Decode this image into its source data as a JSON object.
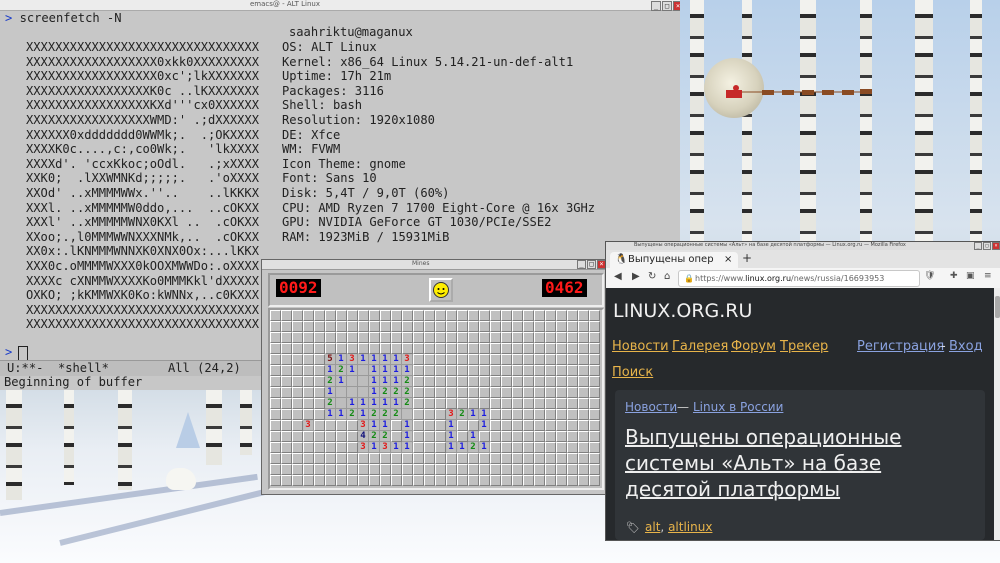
{
  "terminal": {
    "window_title": "emacs@ - ALT Linux",
    "command": "screenfetch -N",
    "prompt_symbol": ">",
    "user_host": "saahriktu@maganux",
    "ascii_art": [
      "XXXXXXXXXXXXXXXXXXXXXXXXXXXXXXXX",
      "XXXXXXXXXXXXXXXXXX0xkk0XXXXXXXXX",
      "XXXXXXXXXXXXXXXXXX0xc';lkXXXXXXX",
      "XXXXXXXXXXXXXXXXXK0c ..lKXXXXXXX",
      "XXXXXXXXXXXXXXXXXKXd'''cx0XXXXXX",
      "XXXXXXXXXXXXXXXXXWMD:' .;dXXXXXX",
      "XXXXXX0xddddddd0WWMk;.  .;OKXXXX",
      "XXXXK0c....,c:,co0Wk;.   'lkXXXX",
      "XXXXd'. 'ccxKkoc;oOdl.   .;xXXXX",
      "XXK0;  .lXXWMNKd;;;;;.   .'oXXXX",
      "XXOd' ..xMMMMWWx.''..    ..lKKKX",
      "XXXl. ..xMMMMMW0ddo,...  ..cOKXX",
      "XXXl' ..xMMMMMWNX0KXl ..  .cOKXX",
      "XXoo;.,l0MMMWWNXXXNMk,..  .cOKXX",
      "XX0x:.lKNMMMWNNXK0XNX0Ox:...lKKX",
      "XXX0c.oMMMMWXXX0kOOXMWWDo:.oXXXX",
      "XXXXc cXNMMWXXXXKo0MMMKkl'dXXXXX",
      "OXKO; ;kKMMWXK0Ko:kWNNx,..c0KXXX",
      "XXXXXXXXXXXXXXXXXXXXXXXXXXXXXXXX",
      "XXXXXXXXXXXXXXXXXXXXXXXXXXXXXXXX"
    ],
    "info": [
      "OS: ALT Linux",
      "Kernel: x86_64 Linux 5.14.21-un-def-alt1",
      "Uptime: 17h 21m",
      "Packages: 3116",
      "Shell: bash",
      "Resolution: 1920x1080",
      "DE: Xfce",
      "WM: FVWM",
      "Icon Theme: gnome",
      "Font: Sans 10",
      "Disk: 5,4T / 9,0T (60%)",
      "CPU: AMD Ryzen 7 1700 Eight-Core @ 16x 3GHz",
      "GPU: NVIDIA GeForce GT 1030/PCIe/SSE2",
      "RAM: 1923MiB / 15931MiB"
    ],
    "modeline": "U:**-  *shell*",
    "modeline_pos": "All (24,2)",
    "minibuffer": "Beginning of buffer"
  },
  "minesweeper": {
    "window_title": "Mines",
    "mines_left": "0092",
    "timer": "0462",
    "cols": 30,
    "rows": 16,
    "opened": [
      {
        "r": 4,
        "c": 5,
        "v": "5"
      },
      {
        "r": 4,
        "c": 6,
        "v": "1"
      },
      {
        "r": 4,
        "c": 7,
        "v": "3"
      },
      {
        "r": 4,
        "c": 8,
        "v": "1"
      },
      {
        "r": 4,
        "c": 9,
        "v": "1"
      },
      {
        "r": 4,
        "c": 10,
        "v": "1"
      },
      {
        "r": 4,
        "c": 11,
        "v": "1"
      },
      {
        "r": 4,
        "c": 12,
        "v": "3"
      },
      {
        "r": 5,
        "c": 5,
        "v": "1"
      },
      {
        "r": 5,
        "c": 6,
        "v": "2"
      },
      {
        "r": 5,
        "c": 7,
        "v": "1"
      },
      {
        "r": 5,
        "c": 8,
        "v": ""
      },
      {
        "r": 5,
        "c": 9,
        "v": "1"
      },
      {
        "r": 5,
        "c": 10,
        "v": "1"
      },
      {
        "r": 5,
        "c": 11,
        "v": "1"
      },
      {
        "r": 5,
        "c": 12,
        "v": "1"
      },
      {
        "r": 6,
        "c": 5,
        "v": "2"
      },
      {
        "r": 6,
        "c": 6,
        "v": "1"
      },
      {
        "r": 6,
        "c": 7,
        "v": ""
      },
      {
        "r": 6,
        "c": 8,
        "v": ""
      },
      {
        "r": 6,
        "c": 9,
        "v": "1"
      },
      {
        "r": 6,
        "c": 10,
        "v": "1"
      },
      {
        "r": 6,
        "c": 11,
        "v": "1"
      },
      {
        "r": 6,
        "c": 12,
        "v": "2"
      },
      {
        "r": 7,
        "c": 5,
        "v": "1"
      },
      {
        "r": 7,
        "c": 6,
        "v": ""
      },
      {
        "r": 7,
        "c": 7,
        "v": ""
      },
      {
        "r": 7,
        "c": 8,
        "v": ""
      },
      {
        "r": 7,
        "c": 9,
        "v": "1"
      },
      {
        "r": 7,
        "c": 10,
        "v": "2"
      },
      {
        "r": 7,
        "c": 11,
        "v": "2"
      },
      {
        "r": 7,
        "c": 12,
        "v": "2"
      },
      {
        "r": 8,
        "c": 5,
        "v": "2"
      },
      {
        "r": 8,
        "c": 6,
        "v": ""
      },
      {
        "r": 8,
        "c": 7,
        "v": "1"
      },
      {
        "r": 8,
        "c": 8,
        "v": "1"
      },
      {
        "r": 8,
        "c": 9,
        "v": "1"
      },
      {
        "r": 8,
        "c": 10,
        "v": "1"
      },
      {
        "r": 8,
        "c": 11,
        "v": "1"
      },
      {
        "r": 8,
        "c": 12,
        "v": "2"
      },
      {
        "r": 9,
        "c": 5,
        "v": "1"
      },
      {
        "r": 9,
        "c": 6,
        "v": "1"
      },
      {
        "r": 9,
        "c": 7,
        "v": "2"
      },
      {
        "r": 9,
        "c": 8,
        "v": "1"
      },
      {
        "r": 9,
        "c": 9,
        "v": "2"
      },
      {
        "r": 9,
        "c": 10,
        "v": "2"
      },
      {
        "r": 9,
        "c": 11,
        "v": "2"
      },
      {
        "r": 9,
        "c": 12,
        "v": ""
      },
      {
        "r": 9,
        "c": 16,
        "v": "3"
      },
      {
        "r": 9,
        "c": 17,
        "v": "2"
      },
      {
        "r": 9,
        "c": 18,
        "v": "1"
      },
      {
        "r": 9,
        "c": 19,
        "v": "1"
      },
      {
        "r": 10,
        "c": 3,
        "v": "3"
      },
      {
        "r": 10,
        "c": 8,
        "v": "3"
      },
      {
        "r": 10,
        "c": 9,
        "v": "1"
      },
      {
        "r": 10,
        "c": 10,
        "v": "1"
      },
      {
        "r": 10,
        "c": 12,
        "v": "1"
      },
      {
        "r": 10,
        "c": 16,
        "v": "1"
      },
      {
        "r": 10,
        "c": 19,
        "v": "1"
      },
      {
        "r": 11,
        "c": 8,
        "v": "4"
      },
      {
        "r": 11,
        "c": 9,
        "v": "2"
      },
      {
        "r": 11,
        "c": 10,
        "v": "2"
      },
      {
        "r": 11,
        "c": 12,
        "v": "1"
      },
      {
        "r": 11,
        "c": 16,
        "v": "1"
      },
      {
        "r": 11,
        "c": 18,
        "v": "1"
      },
      {
        "r": 12,
        "c": 8,
        "v": "3"
      },
      {
        "r": 12,
        "c": 9,
        "v": "1"
      },
      {
        "r": 12,
        "c": 10,
        "v": "3"
      },
      {
        "r": 12,
        "c": 11,
        "v": "1"
      },
      {
        "r": 12,
        "c": 12,
        "v": "1"
      },
      {
        "r": 12,
        "c": 16,
        "v": "1"
      },
      {
        "r": 12,
        "c": 17,
        "v": "1"
      },
      {
        "r": 12,
        "c": 18,
        "v": "2"
      },
      {
        "r": 12,
        "c": 19,
        "v": "1"
      }
    ]
  },
  "browser": {
    "window_title": "Выпущены операционные системы «Альт» на базе десятой платформы — Linux.org.ru — Mozilla Firefox",
    "tab_label": "Выпущены опер",
    "new_tab": "+",
    "url_prefix": "https://www.",
    "url_domain": "linux.org.ru",
    "url_path": "/news/russia/16693953",
    "site_name": "LINUX.ORG.RU",
    "nav": {
      "news": "Новости",
      "gallery": "Галерея",
      "forum": "Форум",
      "tracker": "Трекер",
      "register": "Регистрация",
      "dash": "-",
      "login": "Вход",
      "search": "Поиск"
    },
    "crumb_news": "Новости",
    "crumb_dash": "—",
    "crumb_section": "Linux в России",
    "headline": "Выпущены операционные системы «Альт» на базе десятой платформы",
    "tags": [
      "alt",
      "altlinux"
    ],
    "tag_sep": ","
  },
  "colors": {
    "accent": "#e8b44a",
    "link": "#8aa2e0",
    "term_bg": "#c7c7c7",
    "lcd": "#ff1a1a"
  },
  "icons": [
    "close-icon",
    "maximize-icon",
    "minimize-icon",
    "smiley-icon",
    "back-icon",
    "forward-icon",
    "reload-icon",
    "home-icon",
    "lock-icon",
    "tag-icon",
    "menu-icon"
  ]
}
